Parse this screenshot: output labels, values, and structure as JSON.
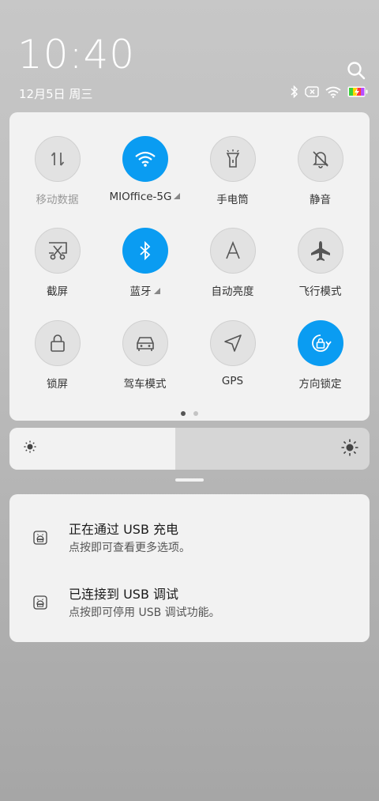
{
  "lockscreen": {
    "time": "10:40",
    "date": "12月5日 周三"
  },
  "status_icons": [
    "bluetooth-icon",
    "no-sim-icon",
    "wifi-icon",
    "battery-charging-icon"
  ],
  "quick_settings": {
    "tiles": [
      {
        "label": "移动数据",
        "icon": "mobile-data-icon",
        "active": false
      },
      {
        "label": "MIOffice-5G",
        "icon": "wifi-icon",
        "active": true
      },
      {
        "label": "手电筒",
        "icon": "flashlight-icon",
        "active": false
      },
      {
        "label": "静音",
        "icon": "silent-icon",
        "active": false
      },
      {
        "label": "截屏",
        "icon": "screenshot-icon",
        "active": false
      },
      {
        "label": "蓝牙",
        "icon": "bluetooth-icon",
        "active": true
      },
      {
        "label": "自动亮度",
        "icon": "auto-brightness-icon",
        "active": false
      },
      {
        "label": "飞行模式",
        "icon": "airplane-icon",
        "active": false
      },
      {
        "label": "锁屏",
        "icon": "lock-icon",
        "active": false
      },
      {
        "label": "驾车模式",
        "icon": "car-icon",
        "active": false
      },
      {
        "label": "GPS",
        "icon": "location-arrow-icon",
        "active": false
      },
      {
        "label": "方向锁定",
        "icon": "rotation-lock-icon",
        "active": true
      }
    ],
    "page_count": 2,
    "current_page": 1
  },
  "brightness": {
    "level_percent": 46
  },
  "notifications": [
    {
      "title": "正在通过 USB 充电",
      "subtitle": "点按即可查看更多选项。",
      "icon": "android-icon"
    },
    {
      "title": "已连接到 USB 调试",
      "subtitle": "点按即可停用 USB 调试功能。",
      "icon": "android-icon"
    }
  ],
  "colors": {
    "accent": "#0a9cf2",
    "panel": "#f2f2f2"
  }
}
